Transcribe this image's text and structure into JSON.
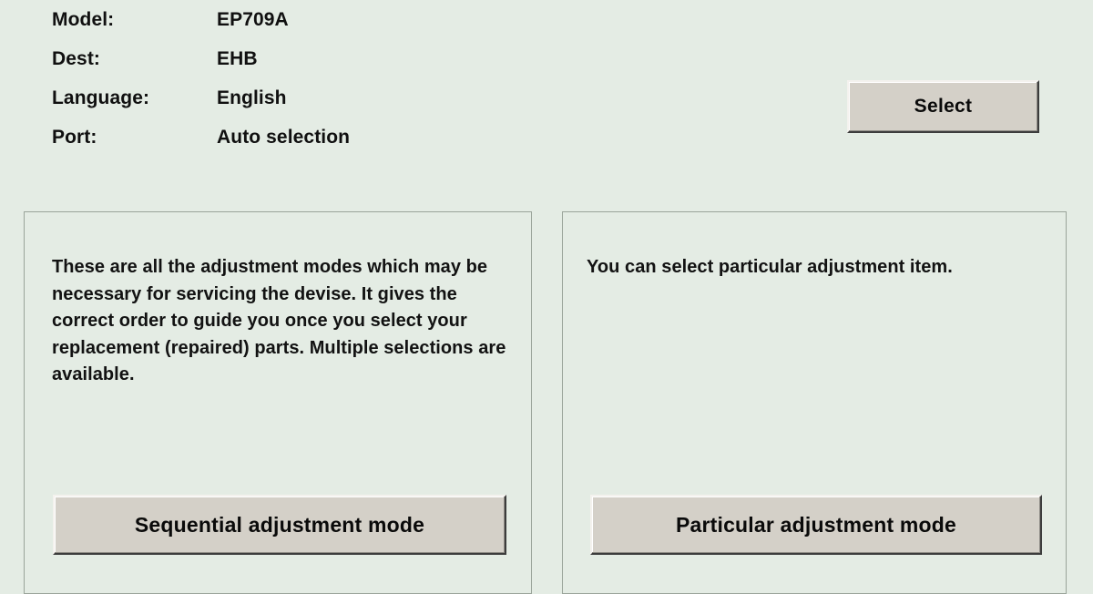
{
  "device_info": {
    "rows": [
      {
        "label": "Model:",
        "value": "EP709A"
      },
      {
        "label": "Dest:",
        "value": "EHB"
      },
      {
        "label": "Language:",
        "value": "English"
      },
      {
        "label": "Port:",
        "value": "Auto selection"
      }
    ]
  },
  "buttons": {
    "select": "Select",
    "sequential_mode": "Sequential adjustment mode",
    "particular_mode": "Particular adjustment mode"
  },
  "panels": {
    "sequential": {
      "description": "These are all the adjustment modes which may be necessary for servicing the devise. It gives the correct order to guide you once you select your replacement (repaired) parts. Multiple selections are available."
    },
    "particular": {
      "description": "You can select particular adjustment item."
    }
  },
  "colors": {
    "background": "#e4ece4",
    "button_face": "#d4d0c8",
    "button_highlight": "#f4f2ee",
    "button_shadow": "#3c3c3c",
    "panel_border": "#9aa49a",
    "text": "#101010"
  }
}
